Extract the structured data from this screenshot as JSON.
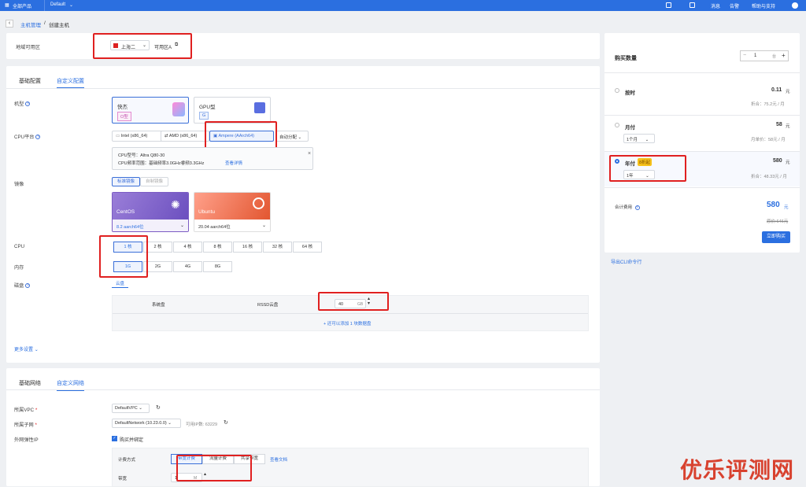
{
  "topbar": {
    "product": "全部产品",
    "project": "Default",
    "links": [
      "消息",
      "告警",
      "帮助与支持"
    ]
  },
  "breadcrumb": {
    "parent": "主机管理",
    "sep": "/",
    "current": "创建主机"
  },
  "region": {
    "label": "地域可用区",
    "value": "上海二",
    "zone": "可用区A"
  },
  "config_tabs": [
    "基础配置",
    "自定义配置"
  ],
  "machine": {
    "label": "机型",
    "types": [
      {
        "name": "快杰",
        "tag": "O型"
      },
      {
        "name": "GPU型",
        "tag": "G"
      }
    ]
  },
  "cpu_platform": {
    "label": "CPU平台",
    "options": [
      "Intel (x86_64)",
      "AMD (x86_64)",
      "Ampere (AArch64)"
    ],
    "auto": "自动分配"
  },
  "cpu_info": {
    "model": "CPU型号：Altra Q80-30",
    "freq": "CPU频率范围：基础频率3.0GHz睿频3.3GHz",
    "more": "查看详情",
    "close": "×"
  },
  "image": {
    "label": "镜像",
    "tabs": [
      "标准镜像",
      "自制镜像"
    ],
    "items": [
      {
        "name": "CentOS",
        "version": "8.2 aarch64位"
      },
      {
        "name": "Ubuntu",
        "version": "20.04 aarch64位"
      }
    ]
  },
  "cpu": {
    "label": "CPU",
    "options": [
      "1 核",
      "2 核",
      "4 核",
      "8 核",
      "16 核",
      "32 核",
      "64 核"
    ]
  },
  "memory": {
    "label": "内存",
    "options": [
      "1G",
      "2G",
      "4G",
      "8G"
    ]
  },
  "disk": {
    "label": "磁盘",
    "tab": "云盘",
    "system": "系统盘",
    "type": "RSSD云盘",
    "size": "40",
    "unit": "GB",
    "add": "+ 还可以添加 1 块数据盘"
  },
  "more_settings": "更多设置",
  "network_tabs": [
    "基础网络",
    "自定义网络"
  ],
  "vpc": {
    "label": "所属VPC",
    "value": "DefaultVPC"
  },
  "subnet": {
    "label": "所属子网",
    "value": "DefaultNetwork (10.23.0.0)",
    "available": "可用IP数: 63229"
  },
  "eip": {
    "label": "外网弹性IP",
    "check": "购买并绑定"
  },
  "billing_mode": {
    "label": "计费方式",
    "options": [
      "带宽计费",
      "流量计费",
      "共享带宽"
    ],
    "doc": "查看文档"
  },
  "bandwidth": {
    "label": "带宽",
    "value": "1",
    "unit": "M"
  },
  "purchase": {
    "qty_label": "购买数量",
    "qty": "1",
    "unit": "台"
  },
  "plans": [
    {
      "name": "按时",
      "price": "0.11",
      "cur": "元",
      "note": "折合：75.2元 / 月"
    },
    {
      "name": "月付",
      "price": "58",
      "cur": "元",
      "select": "1个月",
      "note": "月单价：58元 / 月"
    },
    {
      "name": "年付",
      "badge": "8折起",
      "price": "580",
      "cur": "元",
      "select": "1年",
      "note": "折合：48.33元 / 月"
    }
  ],
  "total": {
    "label": "合计费用",
    "price": "580",
    "cur": "元",
    "orig": "原价:646元",
    "buy": "立即购买"
  },
  "cli": "导出CLI命令行",
  "watermark": "优乐评测网"
}
